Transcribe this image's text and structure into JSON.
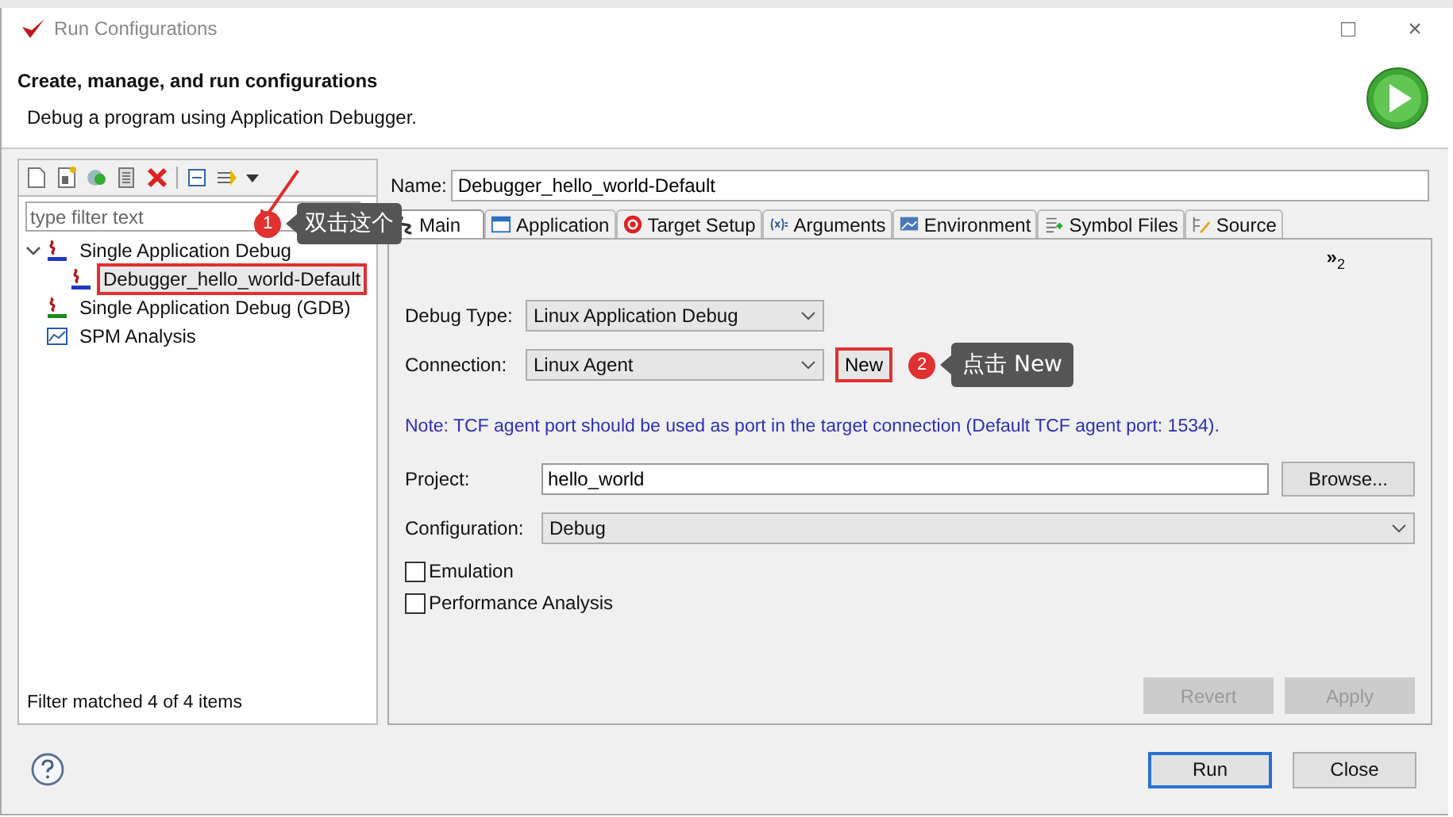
{
  "window": {
    "title": "Run Configurations",
    "controls": [
      "□",
      "×"
    ]
  },
  "header": {
    "title": "Create, manage, and run configurations",
    "subtitle": "Debug a program using Application Debugger."
  },
  "sidebar": {
    "filter": {
      "placeholder": "type filter text"
    },
    "tree": [
      {
        "label": "Single Application Debug",
        "kind": "tcf",
        "expanded": true,
        "selected": false,
        "children": [
          {
            "label": "Debugger_hello_world-Default",
            "kind": "tcf",
            "selected": true
          }
        ]
      },
      {
        "label": "Single Application Debug (GDB)",
        "kind": "gdb",
        "selected": false
      },
      {
        "label": "SPM Analysis",
        "kind": "spm",
        "selected": false
      }
    ],
    "status": "Filter matched 4 of 4 items"
  },
  "name": {
    "label": "Name:",
    "value": "Debugger_hello_world-Default"
  },
  "tabs": [
    {
      "label": "Main",
      "kind": "main",
      "selected": true
    },
    {
      "label": "Application",
      "kind": "app",
      "selected": false
    },
    {
      "label": "Target Setup",
      "kind": "target",
      "selected": false
    },
    {
      "label": "Arguments",
      "kind": "args",
      "selected": false
    },
    {
      "label": "Environment",
      "kind": "env",
      "selected": false
    },
    {
      "label": "Symbol Files",
      "kind": "sym",
      "selected": false
    },
    {
      "label": "Source",
      "kind": "src",
      "selected": false
    }
  ],
  "more_tabs": {
    "glyph": "»",
    "count": "2"
  },
  "form": {
    "debug_type": {
      "label": "Debug Type:",
      "value": "Linux Application Debug"
    },
    "connection": {
      "label": "Connection:",
      "value": "Linux Agent",
      "button": "New"
    },
    "note": "Note: TCF agent port should be used as port in the target connection (Default TCF agent port: 1534).",
    "project": {
      "label": "Project:",
      "value": "hello_world",
      "button": "Browse..."
    },
    "configuration": {
      "label": "Configuration:",
      "value": "Debug"
    },
    "checkboxes": [
      {
        "label": "Emulation",
        "checked": false
      },
      {
        "label": "Performance Analysis",
        "checked": false
      }
    ]
  },
  "actions": [
    {
      "label": "Revert",
      "disabled": true
    },
    {
      "label": "Apply",
      "disabled": true
    }
  ],
  "footer_buttons": [
    {
      "label": "Run",
      "default": true
    },
    {
      "label": "Close",
      "default": false
    }
  ],
  "annotations": [
    {
      "number": "1",
      "text": "双击这个"
    },
    {
      "number": "2",
      "text": "点击 New"
    }
  ]
}
